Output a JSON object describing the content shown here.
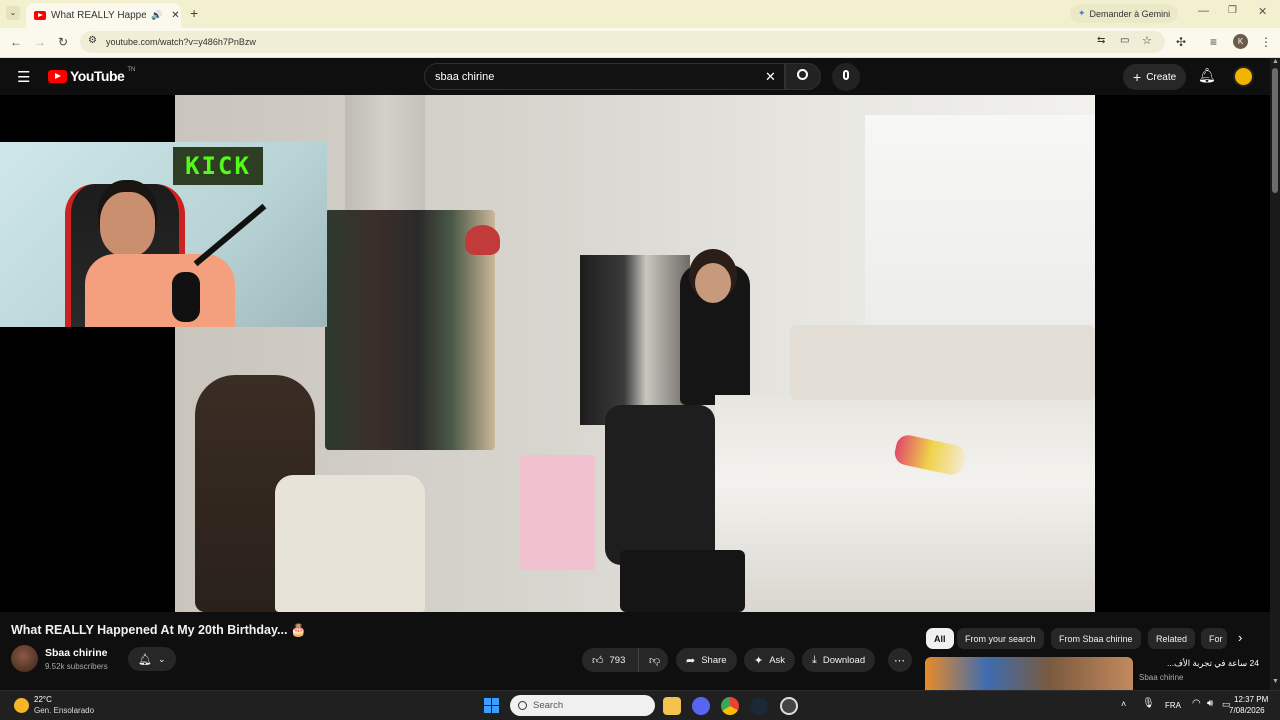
{
  "browser": {
    "tab_title": "What REALLY Happened At",
    "new_tab": "+",
    "gemini_label": "Demander à Gemini",
    "url": "youtube.com/watch?v=y486h7PnBzw",
    "profile_initial": "K"
  },
  "youtube": {
    "logo_text": "YouTube",
    "logo_region": "TN",
    "search_value": "sbaa chirine",
    "create_label": "Create"
  },
  "video": {
    "overlay_logo": "KICK",
    "title": "What REALLY Happened At My 20th Birthday... 🎂",
    "channel_name": "Sbaa chirine",
    "subscribers": "9.52k subscribers",
    "likes": "793",
    "share_label": "Share",
    "ask_label": "Ask",
    "download_label": "Download"
  },
  "chips": [
    "All",
    "From your search",
    "From Sbaa chirine",
    "Related",
    "For"
  ],
  "recommendation": {
    "title_snippet": "24 ساعة في تجربة الأف...",
    "channel": "Sbaa chirine"
  },
  "taskbar": {
    "temperature": "22°C",
    "weather": "Gen. Ensolarado",
    "search_placeholder": "Search",
    "language": "FRA",
    "time": "12:37 PM",
    "date": "7/08/2026"
  }
}
